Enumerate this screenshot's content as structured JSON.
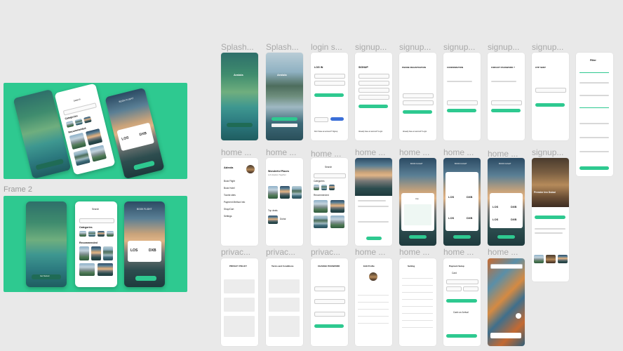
{
  "canvas": {
    "frame2_label": "Frame 2"
  },
  "columns": [
    {
      "label": "Splash..."
    },
    {
      "label": "Splash..."
    },
    {
      "label": "login s..."
    },
    {
      "label": "signup..."
    },
    {
      "label": "signup..."
    },
    {
      "label": "signup..."
    },
    {
      "label": "signup..."
    },
    {
      "label": "signup..."
    }
  ],
  "row2_labels": [
    "home ...",
    "home ...",
    "home ...",
    "home ...",
    "home ...",
    "home ...",
    "home ...",
    "signup..."
  ],
  "row3_labels": [
    "privac...",
    "privac...",
    "privac...",
    "home ...",
    "home ...",
    "home ...",
    "home ..."
  ],
  "splash": {
    "app_name": "Aralola",
    "get_started": "Get Started",
    "login": "Log In",
    "create_account": "Create Account"
  },
  "login": {
    "title": "LOG IN",
    "button": "LOGIN",
    "or": "OR",
    "google": "Google",
    "facebook": "Facebook",
    "no_account": "Don't have an account? Signup"
  },
  "signup": {
    "title": "SIGNUP",
    "button": "SIGNUP",
    "already": "Already have an account? Login"
  },
  "phone_reg": {
    "title": "PHONE REGISTRATION",
    "button": "SEND",
    "already": "Already have an account? Login"
  },
  "confirmation": {
    "title": "CONFIRMATION",
    "button": "CONFIRM"
  },
  "forgot": {
    "title": "FORGOT PASSWORD ?",
    "button": "SEND"
  },
  "otp": {
    "title": "OTP SENT",
    "button": "VERIFY PASSWORD"
  },
  "filter": {
    "title": "Filter",
    "apply": "Apply"
  },
  "home_menu": {
    "name": "Adeola",
    "items": [
      "Book Flight",
      "Book Hotel",
      "Tourist sites",
      "Payment Method Info",
      "Shop/Cart",
      "Settings"
    ]
  },
  "home_places": {
    "title": "Wonderful Places",
    "subtitle": "Let's Explore Together",
    "top_deals": "Top deals",
    "deal_name": "Dubai"
  },
  "home_search": {
    "search": "Search",
    "categories": "Categories",
    "recommended": "Recommended"
  },
  "book_flight": {
    "title": "BOOK FLIGHT",
    "from": "LOS",
    "to": "DXB",
    "month": "July"
  },
  "hotel": {
    "title": "Premier Inn Dubai",
    "button": "BOOK"
  },
  "privacy": {
    "title": "PRIVACY POLICY"
  },
  "terms": {
    "title": "Terms and Conditions"
  },
  "change_pw": {
    "title": "CHANGE PASSWORD",
    "button": "Confirm Password"
  },
  "edit_profile": {
    "title": "Edit Profile",
    "name": "Adeola"
  },
  "settings": {
    "title": "Setting"
  },
  "payment": {
    "title": "Payment Setup",
    "card": "Card",
    "cash": "Cash on Arrival",
    "button": "Add Card"
  },
  "frame1": {
    "search": "Search",
    "categories": "Categories",
    "recommended": "Recommended",
    "book_flight": "BOOK FLIGHT",
    "from": "LOS",
    "to": "DXB"
  },
  "frame2": {
    "search": "Search",
    "categories": "Categories",
    "recommended": "Recommended",
    "book_flight": "BOOK FLIGHT",
    "from": "LOS",
    "to": "DXB",
    "get_started": "Get Started"
  }
}
